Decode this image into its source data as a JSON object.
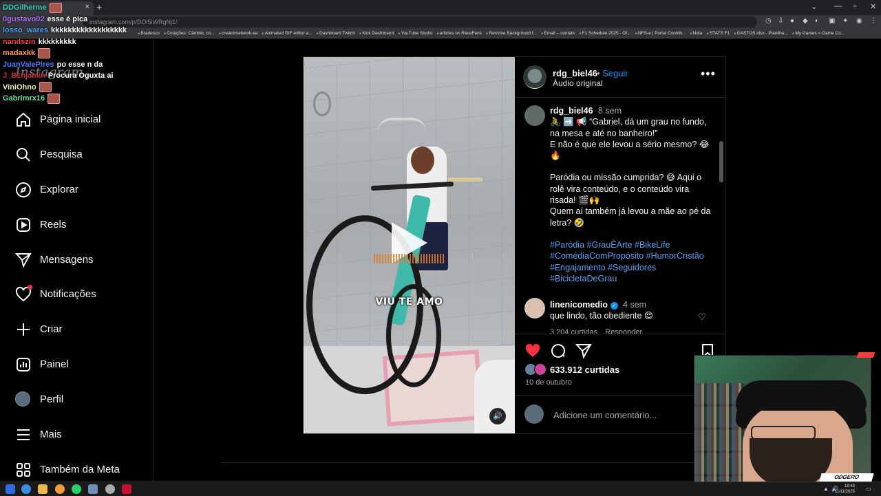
{
  "browser": {
    "tab_close": "×",
    "new_tab": "+",
    "url": "instagram.com/p/DOi5iWRgNj1/",
    "bookmarks": [
      "Bradesco",
      "Cotações: Câmbio, co...",
      "creatornetwork.ea",
      "Animated GIF editor a...",
      "Dashboard Twitch",
      "Kick Dashboard",
      "YouTube Studio",
      "articles on RaceFans",
      "Remove Background f...",
      "Email – contato",
      "F1 Schedule 2025 - Of...",
      "NFS-e | Portal Contrib...",
      "Nota",
      "STATS F1",
      "GASTOS.xlsx - Planilha...",
      "My Games » Game Co..."
    ]
  },
  "chat": [
    {
      "name": "DDGilherme",
      "color": "#3fd2c2",
      "text": ""
    },
    {
      "name": "0gustavo02",
      "color": "#b26cff",
      "text": "esse é pica"
    },
    {
      "name": "losso_wares",
      "color": "#4aa0ff",
      "text": "kkkkkkkkkkkkkkkkkk"
    },
    {
      "name": "nandszin",
      "color": "#ff3c3c",
      "text": "kkkkkkkkk"
    },
    {
      "name": "madaxkk",
      "color": "#ff9f3c",
      "text": ""
    },
    {
      "name": "JuanValePires",
      "color": "#4a7cff",
      "text": "po esse n da"
    },
    {
      "name": "J_B1njamin",
      "color": "#d6263d",
      "text": "Procura Oguxta ai"
    },
    {
      "name": "ViniOhno",
      "color": "#f0f0a0",
      "text": ""
    },
    {
      "name": "Gabrimrx16",
      "color": "#5fe0a0",
      "text": ""
    }
  ],
  "sidebar": {
    "logo": "Instagram",
    "items": [
      {
        "label": "Página inicial",
        "icon": "home-icon"
      },
      {
        "label": "Pesquisa",
        "icon": "search-icon"
      },
      {
        "label": "Explorar",
        "icon": "compass-icon"
      },
      {
        "label": "Reels",
        "icon": "reels-icon"
      },
      {
        "label": "Mensagens",
        "icon": "send-icon"
      },
      {
        "label": "Notificações",
        "icon": "heart-icon"
      },
      {
        "label": "Criar",
        "icon": "plus-icon"
      },
      {
        "label": "Painel",
        "icon": "dashboard-icon"
      },
      {
        "label": "Perfil",
        "icon": "avatar"
      },
      {
        "label": "Mais",
        "icon": "menu-icon"
      },
      {
        "label": "Também da Meta",
        "icon": "meta-apps-icon"
      }
    ]
  },
  "post": {
    "username": "rdg_biel46",
    "follow_sep": "•",
    "follow": "Seguir",
    "audio": "Áudio original",
    "more": "•••",
    "video_caption": "VIU TE AMO",
    "caption": {
      "username": "rdg_biel46",
      "time": "8 sem",
      "line1": "🚴 ➡️ 📢 “Gabriel, dá um grau no fundo, na mesa e até no banheiro!”",
      "line2": "E não é que ele levou a sério mesmo? 😂🔥",
      "line3": "Paródia ou missão cumprida? 😅 Aqui o rolê vira conteúdo, e o conteúdo vira risada! 🎬🙌",
      "line4": "Quem aí também já levou a mãe ao pé da letra? 🤣",
      "hashtags": [
        "#Paródia",
        "#GrauÉArte",
        "#BikeLife",
        "#ComédiaComPropósito",
        "#HumorCristão",
        "#Engajamento",
        "#Seguidores",
        "#BicicletaDeGrau"
      ]
    },
    "comment": {
      "username": "linenicomedio",
      "verified": "✓",
      "time": "4 sem",
      "text": "que lindo, tão obediente 😍",
      "likes": "3.204 curtidas",
      "reply": "Responder"
    },
    "likes": "633.912 curtidas",
    "date": "10 de outubro",
    "add_comment_placeholder": "Adicione um comentário..."
  },
  "webcam": {
    "logo": "ODGERO"
  },
  "taskbar": {
    "time": "18:46",
    "date": "11/11/2025"
  },
  "colors": {
    "accent": "#0095f6",
    "like": "#ff3040",
    "link": "#4ea4f5"
  }
}
